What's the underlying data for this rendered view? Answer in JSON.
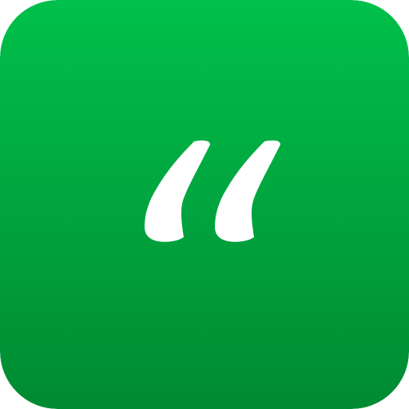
{
  "icon": {
    "name": "quotation-mark-app-icon",
    "glyph": "quote-open-icon",
    "colors": {
      "gradient_top": "#00C04B",
      "gradient_bottom": "#008A32",
      "glyph": "#FFFFFF"
    }
  }
}
